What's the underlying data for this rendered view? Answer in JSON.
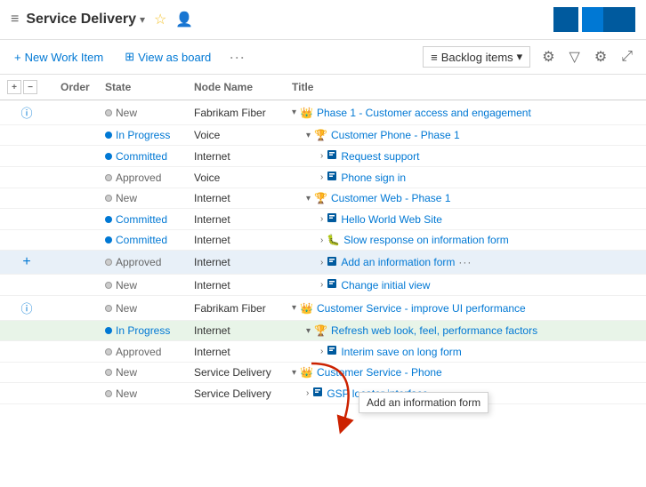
{
  "header": {
    "title": "Service Delivery",
    "icon": "≡"
  },
  "toolbar": {
    "new_work_item": "New Work Item",
    "view_as_board": "View as board",
    "more": "···",
    "backlog_items": "Backlog items",
    "filter_icon": "filter",
    "settings_icon": "settings",
    "expand_icon": "expand"
  },
  "table": {
    "columns": [
      "Order",
      "State",
      "Node Name",
      "Title"
    ],
    "rows": [
      {
        "id": 1,
        "info": true,
        "order": "",
        "state": "New",
        "state_type": "new",
        "node": "Fabrikam Fiber",
        "indent": 1,
        "expand": "collapse",
        "icon": "crown",
        "title": "Phase 1 - Customer access and engagement"
      },
      {
        "id": 2,
        "info": false,
        "order": "",
        "state": "In Progress",
        "state_type": "inprogress",
        "node": "Voice",
        "indent": 2,
        "expand": "collapse",
        "icon": "trophy",
        "title": "Customer Phone - Phase 1"
      },
      {
        "id": 3,
        "info": false,
        "order": "",
        "state": "Committed",
        "state_type": "committed",
        "node": "Internet",
        "indent": 3,
        "expand": "expand",
        "icon": "feature",
        "title": "Request support"
      },
      {
        "id": 4,
        "info": false,
        "order": "",
        "state": "Approved",
        "state_type": "approved",
        "node": "Voice",
        "indent": 3,
        "expand": "expand",
        "icon": "feature",
        "title": "Phone sign in"
      },
      {
        "id": 5,
        "info": false,
        "order": "",
        "state": "New",
        "state_type": "new",
        "node": "Internet",
        "indent": 2,
        "expand": "collapse",
        "icon": "trophy",
        "title": "Customer Web - Phase 1"
      },
      {
        "id": 6,
        "info": false,
        "order": "",
        "state": "Committed",
        "state_type": "committed",
        "node": "Internet",
        "indent": 3,
        "expand": "expand",
        "icon": "feature",
        "title": "Hello World Web Site"
      },
      {
        "id": 7,
        "info": false,
        "order": "",
        "state": "Committed",
        "state_type": "committed",
        "node": "Internet",
        "indent": 3,
        "expand": "expand",
        "icon": "bug",
        "title": "Slow response on information form"
      },
      {
        "id": 8,
        "info": false,
        "order": "",
        "state": "Approved",
        "state_type": "approved",
        "node": "Internet",
        "indent": 3,
        "expand": "expand",
        "icon": "feature",
        "title": "Add an information form",
        "more": true,
        "selected": true
      },
      {
        "id": 9,
        "info": false,
        "order": "",
        "state": "New",
        "state_type": "new",
        "node": "Internet",
        "indent": 3,
        "expand": "expand",
        "icon": "feature",
        "title": "Change initial view"
      },
      {
        "id": 10,
        "info": true,
        "order": "",
        "state": "New",
        "state_type": "new",
        "node": "Fabrikam Fiber",
        "indent": 1,
        "expand": "collapse",
        "icon": "crown",
        "title": "Customer Service - improve UI performance"
      },
      {
        "id": 11,
        "info": false,
        "order": "",
        "state": "In Progress",
        "state_type": "inprogress",
        "node": "Internet",
        "indent": 2,
        "expand": "collapse",
        "icon": "trophy",
        "title": "Refresh web look, feel, performance factors",
        "highlighted": true
      },
      {
        "id": 12,
        "info": false,
        "order": "",
        "state": "Approved",
        "state_type": "approved",
        "node": "Internet",
        "indent": 3,
        "expand": "expand",
        "icon": "feature",
        "title": "Interim save on long form"
      },
      {
        "id": 13,
        "info": false,
        "order": "",
        "state": "New",
        "state_type": "new",
        "node": "Service Delivery",
        "indent": 1,
        "expand": "collapse",
        "icon": "crown",
        "title": "Customer Service - Phone"
      },
      {
        "id": 14,
        "info": false,
        "order": "",
        "state": "New",
        "state_type": "new",
        "node": "Service Delivery",
        "indent": 2,
        "expand": "expand",
        "icon": "feature",
        "title": "GSP locator interface"
      }
    ]
  },
  "tooltip": {
    "text": "Add an information form"
  }
}
